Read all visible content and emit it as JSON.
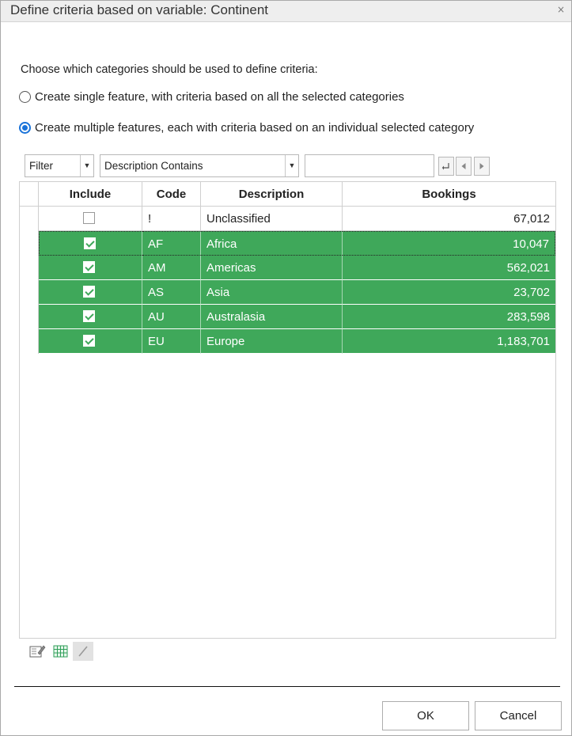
{
  "window": {
    "title": "Define criteria based on variable: Continent",
    "close_glyph": "×"
  },
  "prompt": "Choose which categories should be used to define criteria:",
  "options": [
    {
      "label": "Create single feature, with criteria based on all the selected categories",
      "selected": false
    },
    {
      "label": "Create multiple features, each with criteria based on an individual selected category",
      "selected": true
    }
  ],
  "filter": {
    "mode": "Filter",
    "field": "Description Contains",
    "text": ""
  },
  "table": {
    "headers": {
      "include": "Include",
      "code": "Code",
      "description": "Description",
      "bookings": "Bookings"
    },
    "rows": [
      {
        "include": false,
        "code": "!",
        "description": "Unclassified",
        "bookings": "67,012"
      },
      {
        "include": true,
        "code": "AF",
        "description": "Africa",
        "bookings": "10,047"
      },
      {
        "include": true,
        "code": "AM",
        "description": "Americas",
        "bookings": "562,021"
      },
      {
        "include": true,
        "code": "AS",
        "description": "Asia",
        "bookings": "23,702"
      },
      {
        "include": true,
        "code": "AU",
        "description": "Australasia",
        "bookings": "283,598"
      },
      {
        "include": true,
        "code": "EU",
        "description": "Europe",
        "bookings": "1,183,701"
      }
    ]
  },
  "buttons": {
    "ok": "OK",
    "cancel": "Cancel"
  },
  "colors": {
    "selected_row": "#3fa85a",
    "radio_accent": "#1a73d9"
  }
}
